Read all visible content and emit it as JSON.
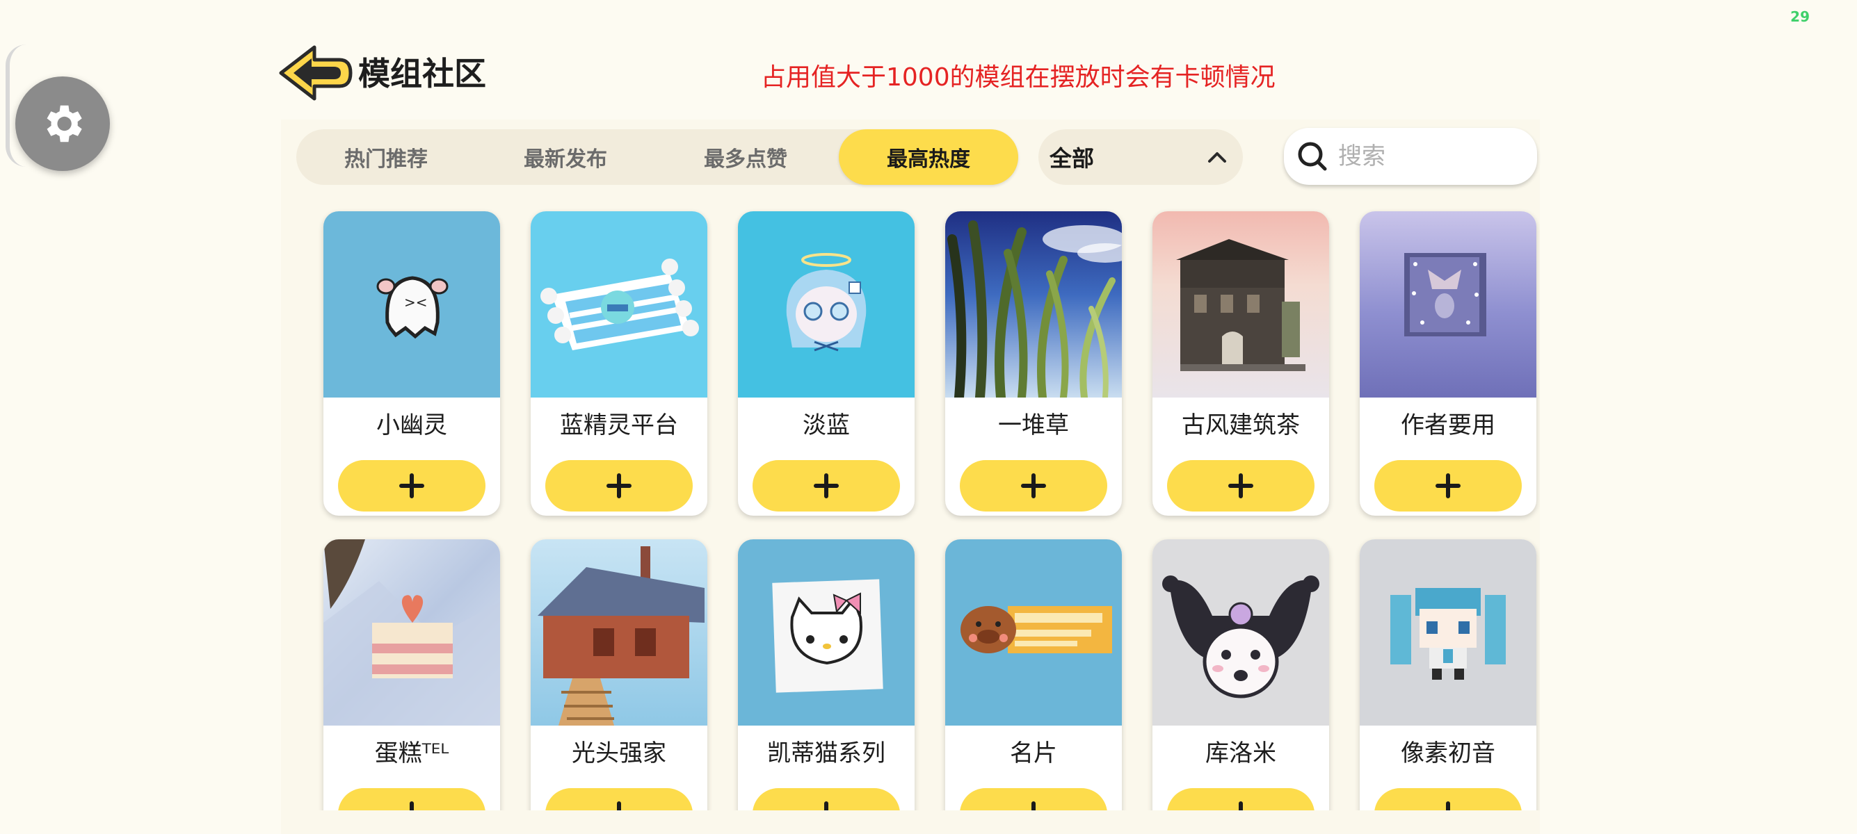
{
  "fps": "29",
  "header": {
    "title": "模组社区",
    "notice": "占用值大于1000的模组在摆放时会有卡顿情况"
  },
  "tabs": [
    {
      "label": "热门推荐",
      "active": false
    },
    {
      "label": "最新发布",
      "active": false
    },
    {
      "label": "最多点赞",
      "active": false
    },
    {
      "label": "最高热度",
      "active": true
    }
  ],
  "filter": {
    "selected": "全部"
  },
  "search": {
    "placeholder": "搜索",
    "value": ""
  },
  "colors": {
    "accent": "#fddc4c",
    "notice": "#e52323",
    "fps": "#3fd06a",
    "background": "#fdfbf2"
  },
  "mods": [
    {
      "name": "小幽灵",
      "thumb_color": "#6cb8da",
      "icon": "ghost-thumbnail"
    },
    {
      "name": "蓝精灵平台",
      "thumb_color": "#68cfee",
      "icon": "platform-thumbnail"
    },
    {
      "name": "淡蓝",
      "thumb_color": "#44c1e2",
      "icon": "blue-girl-thumbnail"
    },
    {
      "name": "一堆草",
      "thumb_color": "#2c3f8f",
      "icon": "grass-thumbnail"
    },
    {
      "name": "古风建筑茶",
      "thumb_color": "#e8d0d0",
      "icon": "building-thumbnail"
    },
    {
      "name": "作者要用",
      "thumb_color": "#7a7dc4",
      "icon": "frame-thumbnail"
    },
    {
      "name": "蛋糕ᵀᴱᴸ",
      "thumb_color": "#c9d6ea",
      "icon": "cake-thumbnail"
    },
    {
      "name": "光头强家",
      "thumb_color": "#8fc8e6",
      "icon": "house-thumbnail"
    },
    {
      "name": "凯蒂猫系列",
      "thumb_color": "#6bb6d8",
      "icon": "hello-kitty-thumbnail"
    },
    {
      "name": "名片",
      "thumb_color": "#6bb6d8",
      "icon": "business-card-thumbnail"
    },
    {
      "name": "库洛米",
      "thumb_color": "#dcdcde",
      "icon": "kuromi-thumbnail"
    },
    {
      "name": "像素初音",
      "thumb_color": "#d4d6da",
      "icon": "pixel-miku-thumbnail"
    }
  ]
}
